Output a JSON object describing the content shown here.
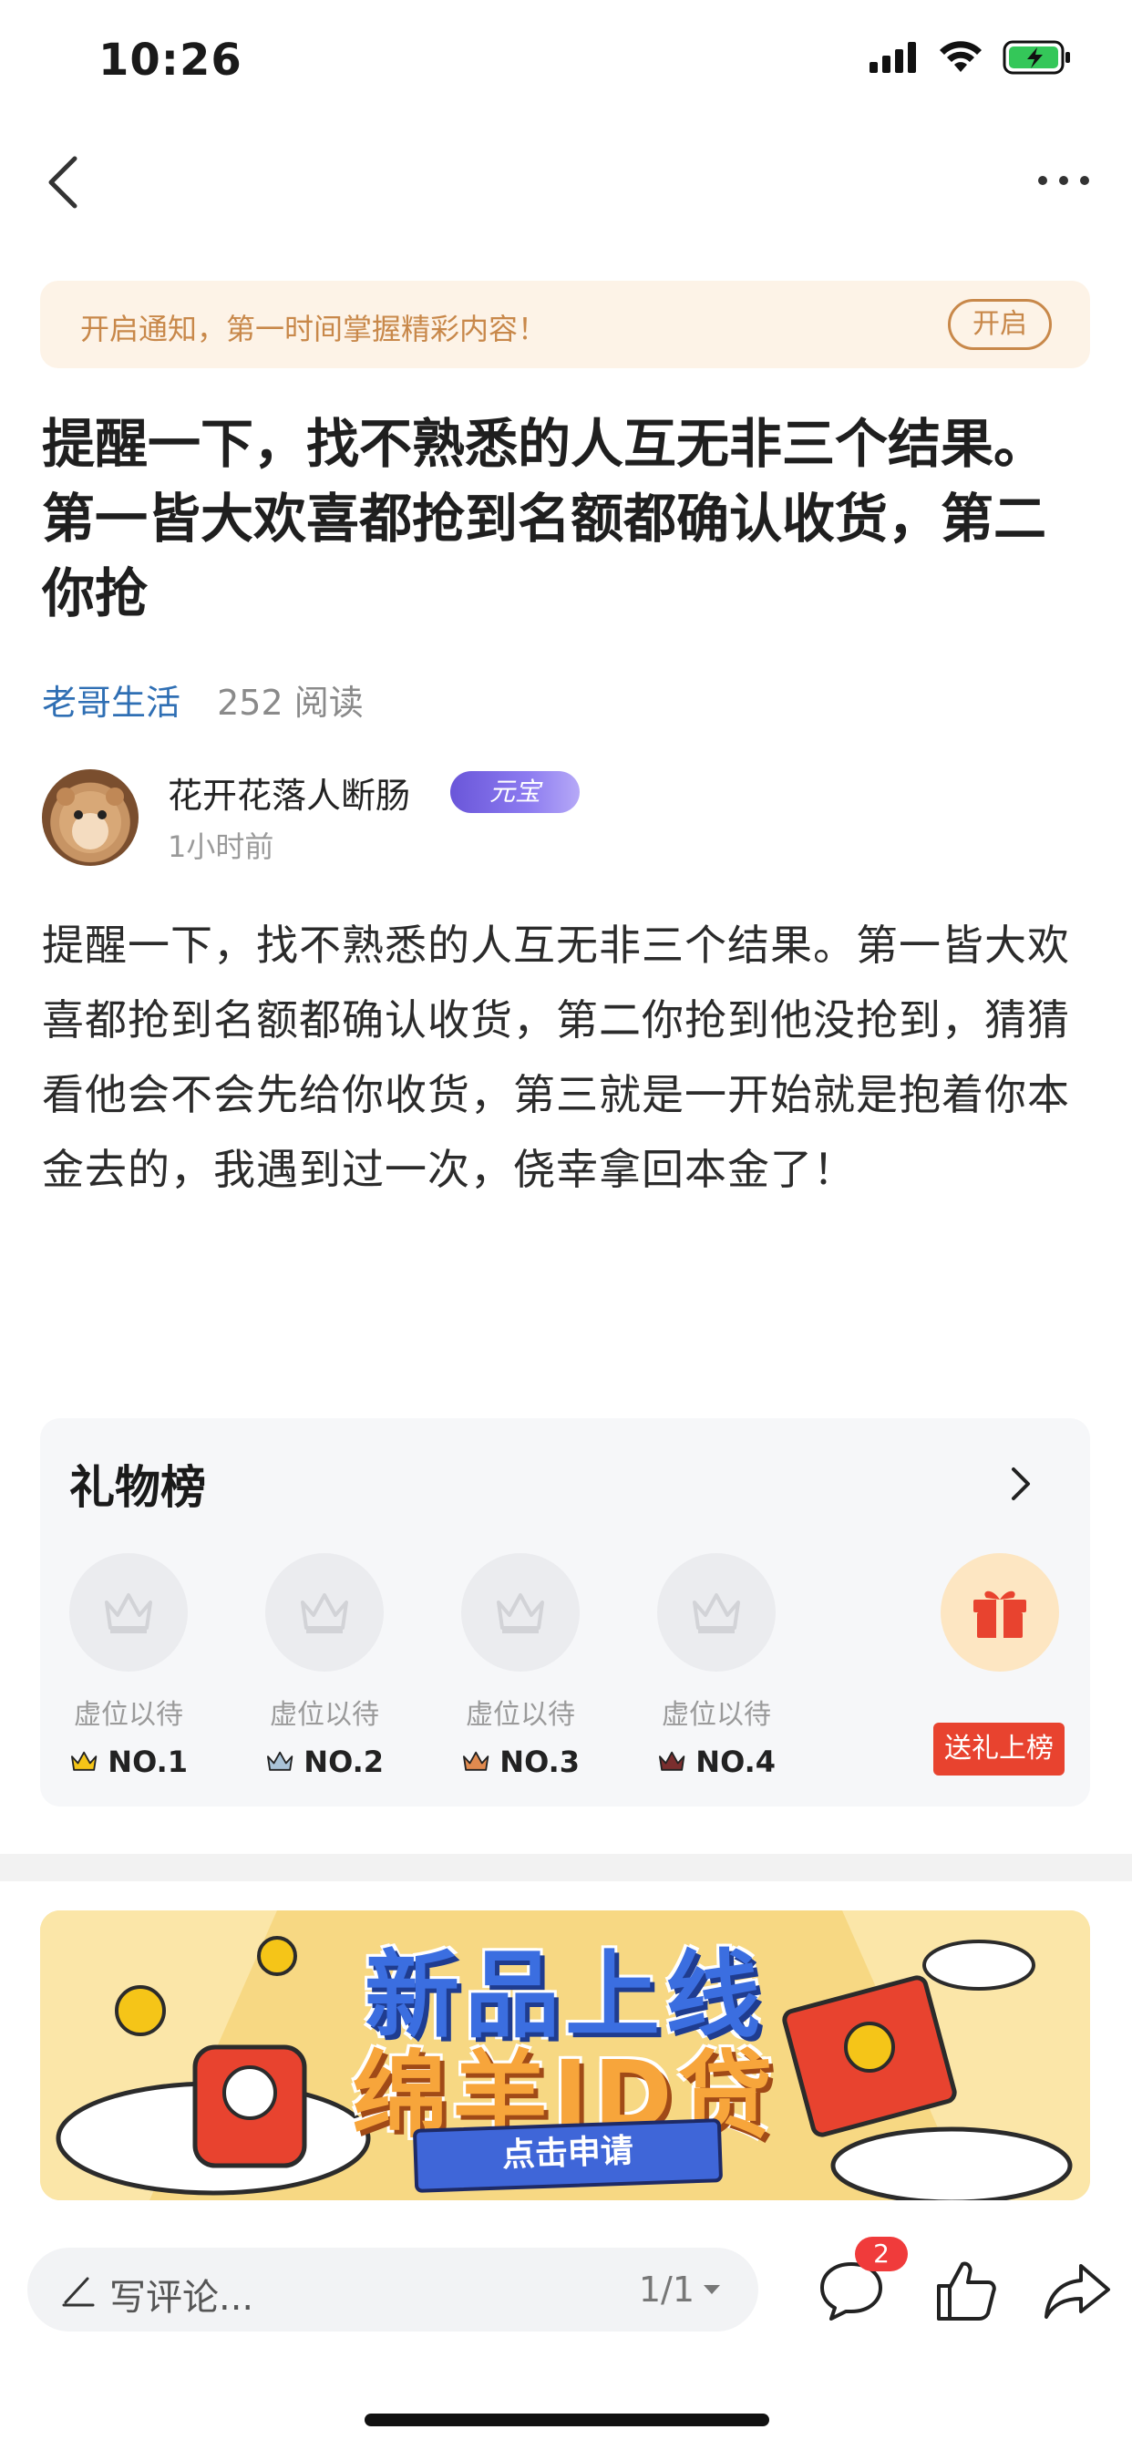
{
  "status_bar": {
    "time": "10:26"
  },
  "notice": {
    "text": "开启通知，第一时间掌握精彩内容！",
    "button": "开启"
  },
  "article": {
    "title": "提醒一下，找不熟悉的人互无非三个结果。第一皆大欢喜都抢到名额都确认收货，第二你抢",
    "category": "老哥生活",
    "reads": "252 阅读",
    "author": {
      "name": "花开花落人断肠",
      "badge": "元宝",
      "time": "1小时前"
    },
    "content": "提醒一下，找不熟悉的人互无非三个结果。第一皆大欢喜都抢到名额都确认收货，第二你抢到他没抢到，猜猜看他会不会先给你收货，第三就是一开始就是抱着你本金去的，我遇到过一次，侥幸拿回本金了！"
  },
  "gift_board": {
    "title": "礼物榜",
    "slots": [
      {
        "label": "虚位以待",
        "rank": "NO.1"
      },
      {
        "label": "虚位以待",
        "rank": "NO.2"
      },
      {
        "label": "虚位以待",
        "rank": "NO.3"
      },
      {
        "label": "虚位以待",
        "rank": "NO.4"
      }
    ],
    "send_button": "送礼上榜",
    "colors": {
      "no1": "#f5c518",
      "no2": "#a9c3d8",
      "no3": "#e08a4f",
      "no4": "#7a2e2e"
    }
  },
  "ad": {
    "line1": "新品上线",
    "line2": "绵羊ID贷",
    "cta": "点击申请"
  },
  "bottom_bar": {
    "comment_placeholder": "写评论...",
    "page": "1/1",
    "comment_count": "2"
  }
}
